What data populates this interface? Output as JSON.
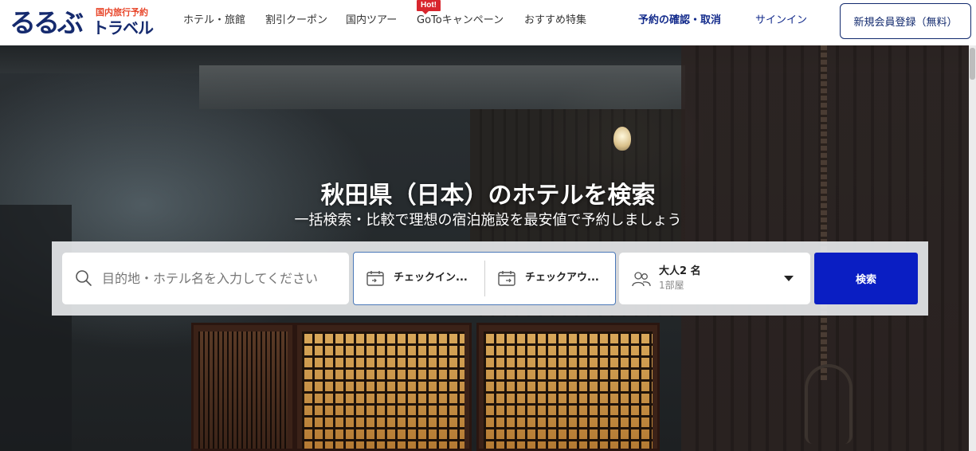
{
  "header": {
    "logo": {
      "main": "るるぶ",
      "sub": "国内旅行予約",
      "travel": "トラベル"
    },
    "nav": [
      {
        "label": "ホテル・旅館"
      },
      {
        "label": "割引クーポン"
      },
      {
        "label": "国内ツアー"
      },
      {
        "label": "GoToキャンペーン",
        "badge": "Hot!"
      },
      {
        "label": "おすすめ特集"
      }
    ],
    "booking_label": "予約の確認・取消",
    "signin_label": "サインイン",
    "register_label": "新規会員登録（無料）"
  },
  "hero": {
    "title": "秋田県（日本）のホテルを検索",
    "subtitle": "一括検索・比較で理想の宿泊施設を最安値で予約しましょう"
  },
  "search": {
    "destination_placeholder": "目的地・ホテル名を入力してください",
    "checkin_label": "チェックイン...",
    "checkout_label": "チェックアウ...",
    "guests_label": "大人2 名",
    "rooms_label": "1部屋",
    "search_button": "検索"
  },
  "colors": {
    "brand_navy": "#152a6e",
    "logo_accent": "#e8462a",
    "search_button": "#0a1ec3",
    "hot_badge": "#d8262e"
  }
}
